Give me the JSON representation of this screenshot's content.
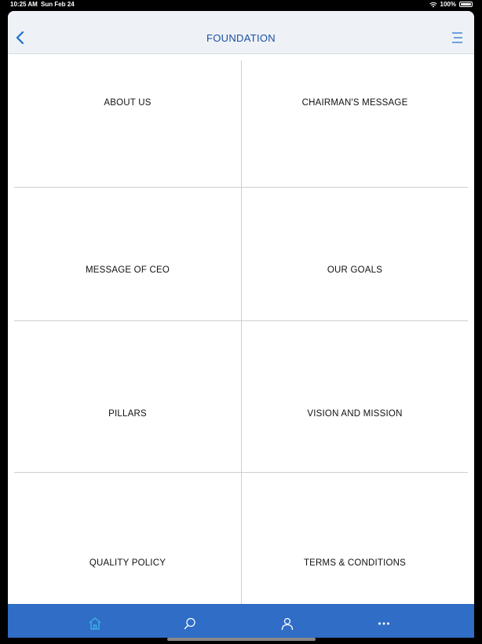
{
  "status_bar": {
    "time": "10:25 AM",
    "date": "Sun Feb 24",
    "battery": "100%"
  },
  "header": {
    "title": "FOUNDATION",
    "back_icon": "chevron-left-icon",
    "menu_icon": "menu-icon"
  },
  "grid": {
    "items": [
      {
        "label": "ABOUT US"
      },
      {
        "label": "CHAIRMAN'S MESSAGE"
      },
      {
        "label": "MESSAGE OF CEO"
      },
      {
        "label": "OUR GOALS"
      },
      {
        "label": "PILLARS"
      },
      {
        "label": "VISION AND MISSION"
      },
      {
        "label": "QUALITY POLICY"
      },
      {
        "label": "TERMS & CONDITIONS"
      }
    ]
  },
  "tab_bar": {
    "tabs": [
      {
        "icon": "home-icon",
        "active": true
      },
      {
        "icon": "search-icon",
        "active": false
      },
      {
        "icon": "profile-icon",
        "active": false
      },
      {
        "icon": "more-icon",
        "active": false
      }
    ]
  },
  "colors": {
    "accent": "#1b4fa0",
    "tab_bar": "#2f6dc7",
    "tab_active": "#41b6e6",
    "nav_bg": "#eef2f6"
  }
}
